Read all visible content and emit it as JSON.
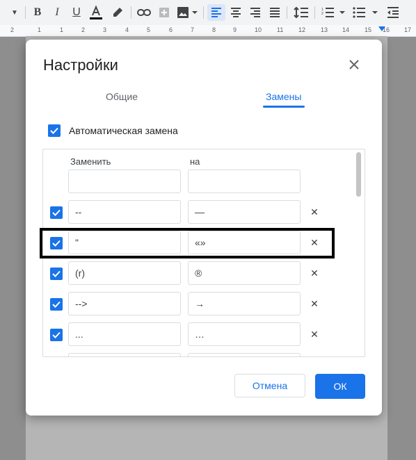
{
  "dialog": {
    "title": "Настройки",
    "tabs": [
      {
        "label": "Общие",
        "active": false
      },
      {
        "label": "Замены",
        "active": true
      }
    ],
    "auto_replace_label": "Автоматическая замена",
    "columns": {
      "replace": "Заменить",
      "with": "на"
    },
    "rows": [
      {
        "replace": "--",
        "with": "—"
      },
      {
        "replace": "\"",
        "with": "«»"
      },
      {
        "replace": "(r)",
        "with": "®"
      },
      {
        "replace": "-->",
        "with": "→"
      },
      {
        "replace": "...",
        "with": "…"
      }
    ],
    "cancel_label": "Отмена",
    "ok_label": "ОК"
  },
  "ruler": {
    "numbers": [
      "2",
      "1",
      "1",
      "2",
      "3",
      "4",
      "5",
      "6",
      "7",
      "8",
      "9",
      "10",
      "11",
      "12",
      "13",
      "14",
      "15",
      "16",
      "17"
    ]
  },
  "colors": {
    "accent": "#1a73e8",
    "overlay": "#8e8e8e"
  }
}
